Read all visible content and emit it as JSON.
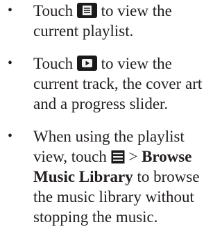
{
  "bullets": [
    {
      "marker": "•",
      "before": "Touch ",
      "icon": "playlist-button-icon",
      "after": " to view the current playlist."
    },
    {
      "marker": "•",
      "before": "Touch ",
      "icon": "now-playing-button-icon",
      "after": " to view the current track, the cover art and a progress slider."
    },
    {
      "marker": "•",
      "before": "When using the playlist view, touch ",
      "icon": "menu-icon",
      "separator": " > ",
      "bold_label": "Browse Music Library",
      "after": " to browse the music library without stopping the music."
    }
  ],
  "colors": {
    "text": "#231f20",
    "icon_background": "#1a1a1a",
    "icon_glyph": "#f2f2f2"
  }
}
